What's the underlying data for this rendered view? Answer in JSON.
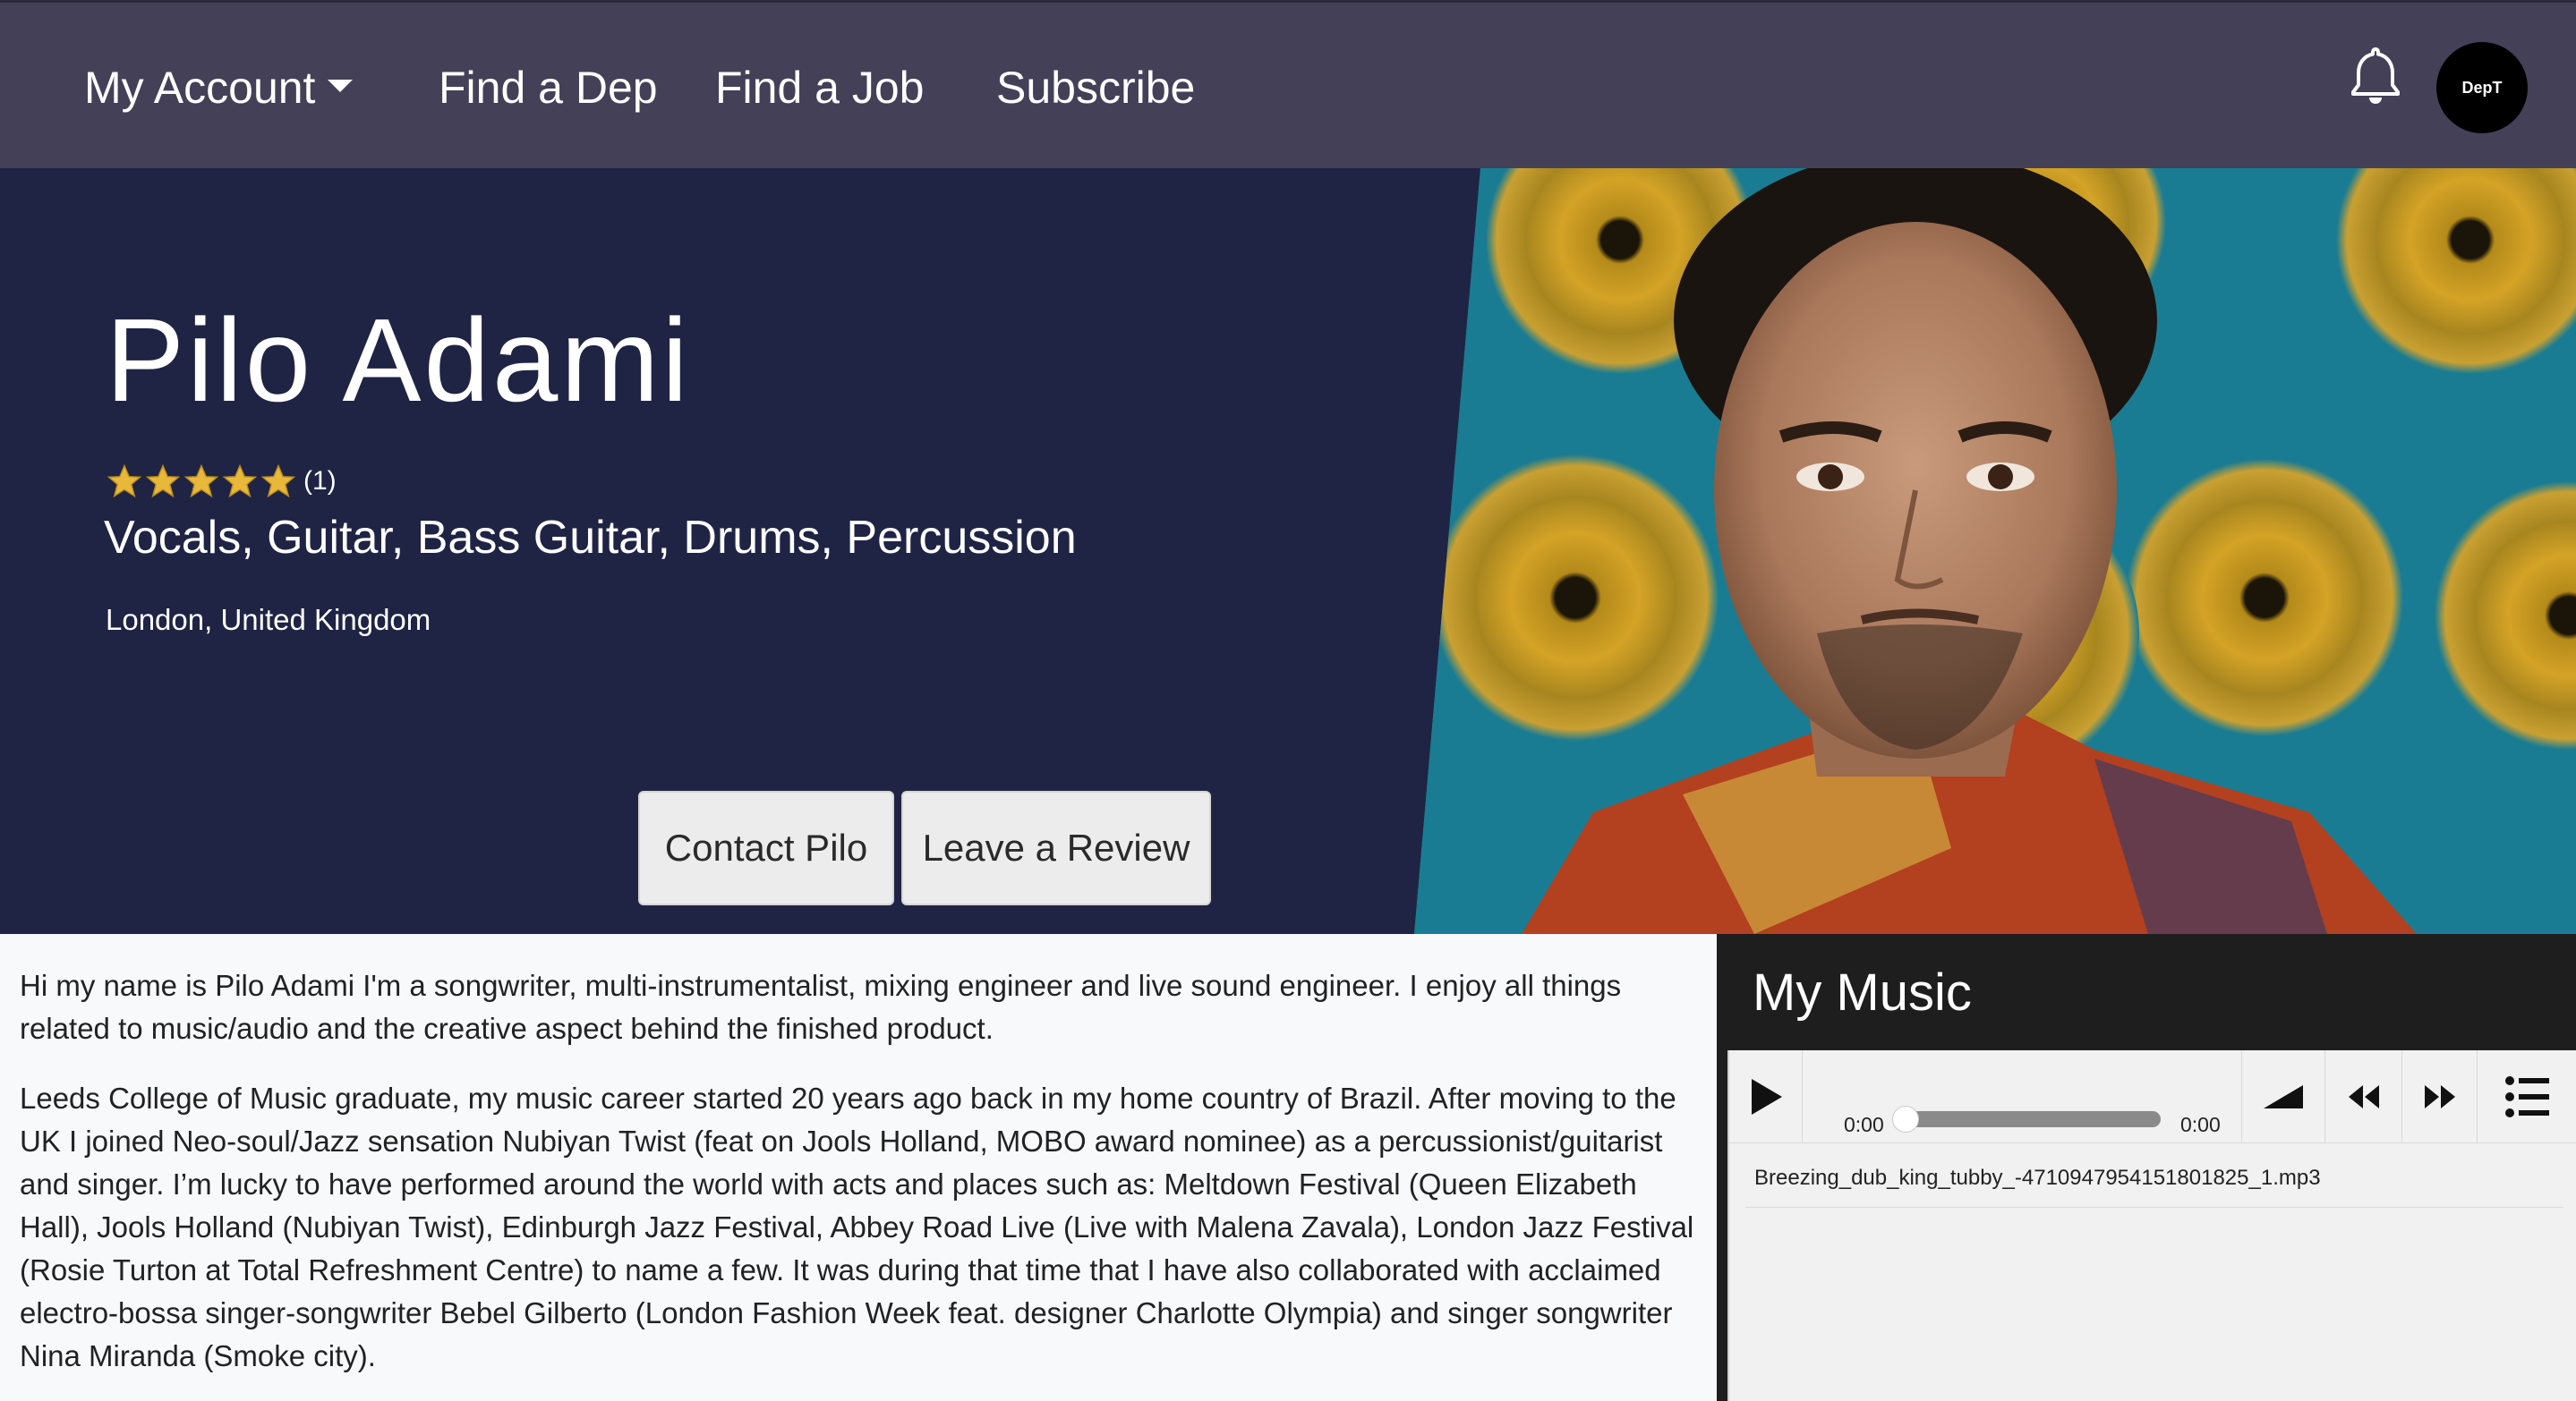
{
  "nav": {
    "account_label": "My Account",
    "find_dep_label": "Find a Dep",
    "find_job_label": "Find a Job",
    "subscribe_label": "Subscribe",
    "avatar_text": "DepT",
    "bell_icon": "bell-icon"
  },
  "profile": {
    "name": "Pilo Adami",
    "rating": 5,
    "rating_max": 5,
    "rating_count": "(1)",
    "instruments": "Vocals, Guitar, Bass Guitar, Drums, Percussion",
    "location": "London, United Kingdom",
    "contact_label": "Contact Pilo",
    "review_label": "Leave a Review"
  },
  "bio": {
    "paragraphs": [
      "Hi my name is Pilo Adami I'm a songwriter, multi-instrumentalist, mixing engineer and live sound engineer. I enjoy all things related to music/audio and the creative aspect behind the finished product.",
      "Leeds College of Music graduate, my music career started 20 years ago back in my home country of Brazil. After moving to the UK I joined Neo-soul/Jazz sensation Nubiyan Twist (feat on Jools Holland, MOBO award nominee) as a percussionist/guitarist and singer. I’m lucky to have performed around the world with acts and places such as: Meltdown Festival (Queen Elizabeth Hall), Jools Holland (Nubiyan Twist), Edinburgh Jazz Festival, Abbey Road Live (Live with Malena Zavala), London Jazz Festival (Rosie Turton at Total Refreshment Centre) to name a few. It was during that time that I have also collaborated with acclaimed electro-bossa singer-songwriter Bebel Gilberto (London Fashion Week feat. designer Charlotte Olympia) and singer songwriter Nina Miranda (Smoke city)."
    ]
  },
  "music": {
    "title": "My Music",
    "current_time": "0:00",
    "duration": "0:00",
    "progress": 0,
    "playlist": [
      "Breezing_dub_king_tubby_-4710947954151801825_1.mp3"
    ]
  },
  "colors": {
    "nav_bg": "#434058",
    "hero_bg": "#1f2444",
    "star": "#e8b83a",
    "music_header_bg": "#1e1e1e"
  }
}
